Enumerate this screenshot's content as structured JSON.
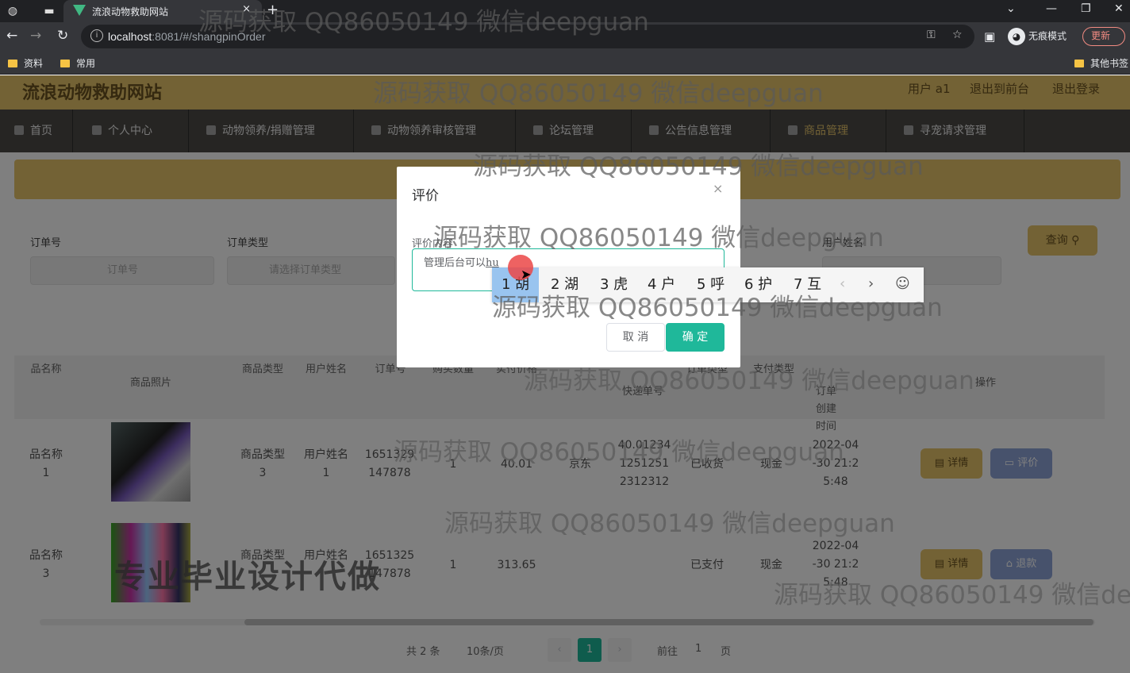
{
  "browser": {
    "tab_title": "流浪动物救助网站",
    "tab_close": "×",
    "new_tab": "+",
    "url_host": "localhost",
    "url_path": ":8081/#/shangpinOrder",
    "incognito_label": "无痕模式",
    "update_label": "更新",
    "bookmarks": [
      "资料",
      "常用"
    ],
    "other_bookmarks": "其他书签"
  },
  "header": {
    "site_title": "流浪动物救助网站",
    "user_label": "用户 a1",
    "back_front": "退出到前台",
    "logout": "退出登录"
  },
  "menu": {
    "items": [
      {
        "label": "首页"
      },
      {
        "label": "个人中心"
      },
      {
        "label": "动物领养/捐赠管理"
      },
      {
        "label": "动物领养审核管理"
      },
      {
        "label": "论坛管理"
      },
      {
        "label": "公告信息管理"
      },
      {
        "label": "商品管理"
      },
      {
        "label": "寻宠请求管理"
      }
    ]
  },
  "filters": {
    "order_no_label": "订单号",
    "order_no_placeholder": "订单号",
    "order_type_label": "订单类型",
    "order_type_placeholder": "请选择订单类型",
    "username_label": "用户姓名",
    "query_button": "查询"
  },
  "table": {
    "headers": [
      "品名称",
      "商品照片",
      "商品类型",
      "用户姓名",
      "订单号",
      "购买数量",
      "实付价格",
      "",
      "快递单号",
      "订单类型",
      "支付类型",
      "订单创建时间",
      "操作"
    ],
    "rows": [
      {
        "name": [
          "品名称",
          "1"
        ],
        "type": [
          "商品类型",
          "3"
        ],
        "user": [
          "用户姓名",
          "1"
        ],
        "order_no": [
          "1651329",
          "147878"
        ],
        "qty": "1",
        "price": "40.01",
        "company": "京东",
        "express": [
          "40.01234",
          "1251251",
          "2312312"
        ],
        "status": "已收货",
        "pay": "现金",
        "time": [
          "2022-04",
          "-30 21:2",
          "5:48"
        ],
        "actions": [
          "详情",
          "评价"
        ]
      },
      {
        "name": [
          "品名称",
          "3"
        ],
        "type": [
          "商品类型",
          ""
        ],
        "user": [
          "用户姓名",
          ""
        ],
        "order_no": [
          "1651325",
          "147878"
        ],
        "qty": "1",
        "price": "313.65",
        "company": "",
        "express": [
          "",
          "",
          ""
        ],
        "status": "已支付",
        "pay": "现金",
        "time": [
          "2022-04",
          "-30 21:2",
          "5:48"
        ],
        "actions": [
          "详情",
          "退款"
        ]
      }
    ]
  },
  "pagination": {
    "total": "共 2 条",
    "page_size": "10条/页",
    "current": "1",
    "goto_label": "前往",
    "goto_value": "1",
    "page_unit": "页"
  },
  "dialog": {
    "title": "评价",
    "close": "×",
    "label": "评价内容",
    "text": "管理后台可以",
    "pinyin": "hu",
    "cancel": "取 消",
    "confirm": "确 定"
  },
  "ime": {
    "candidates": [
      "1 胡",
      "2 湖",
      "3 虎",
      "4 户",
      "5 呼",
      "6 护",
      "7 互"
    ],
    "prev": "‹",
    "next": "›",
    "emoji": "☺"
  },
  "watermark": {
    "text": "源码获取 QQ86050149 微信deepguan",
    "text_cut": "源码获取 QQ86050149 微信deep",
    "promo": "专业毕业设计代做"
  }
}
